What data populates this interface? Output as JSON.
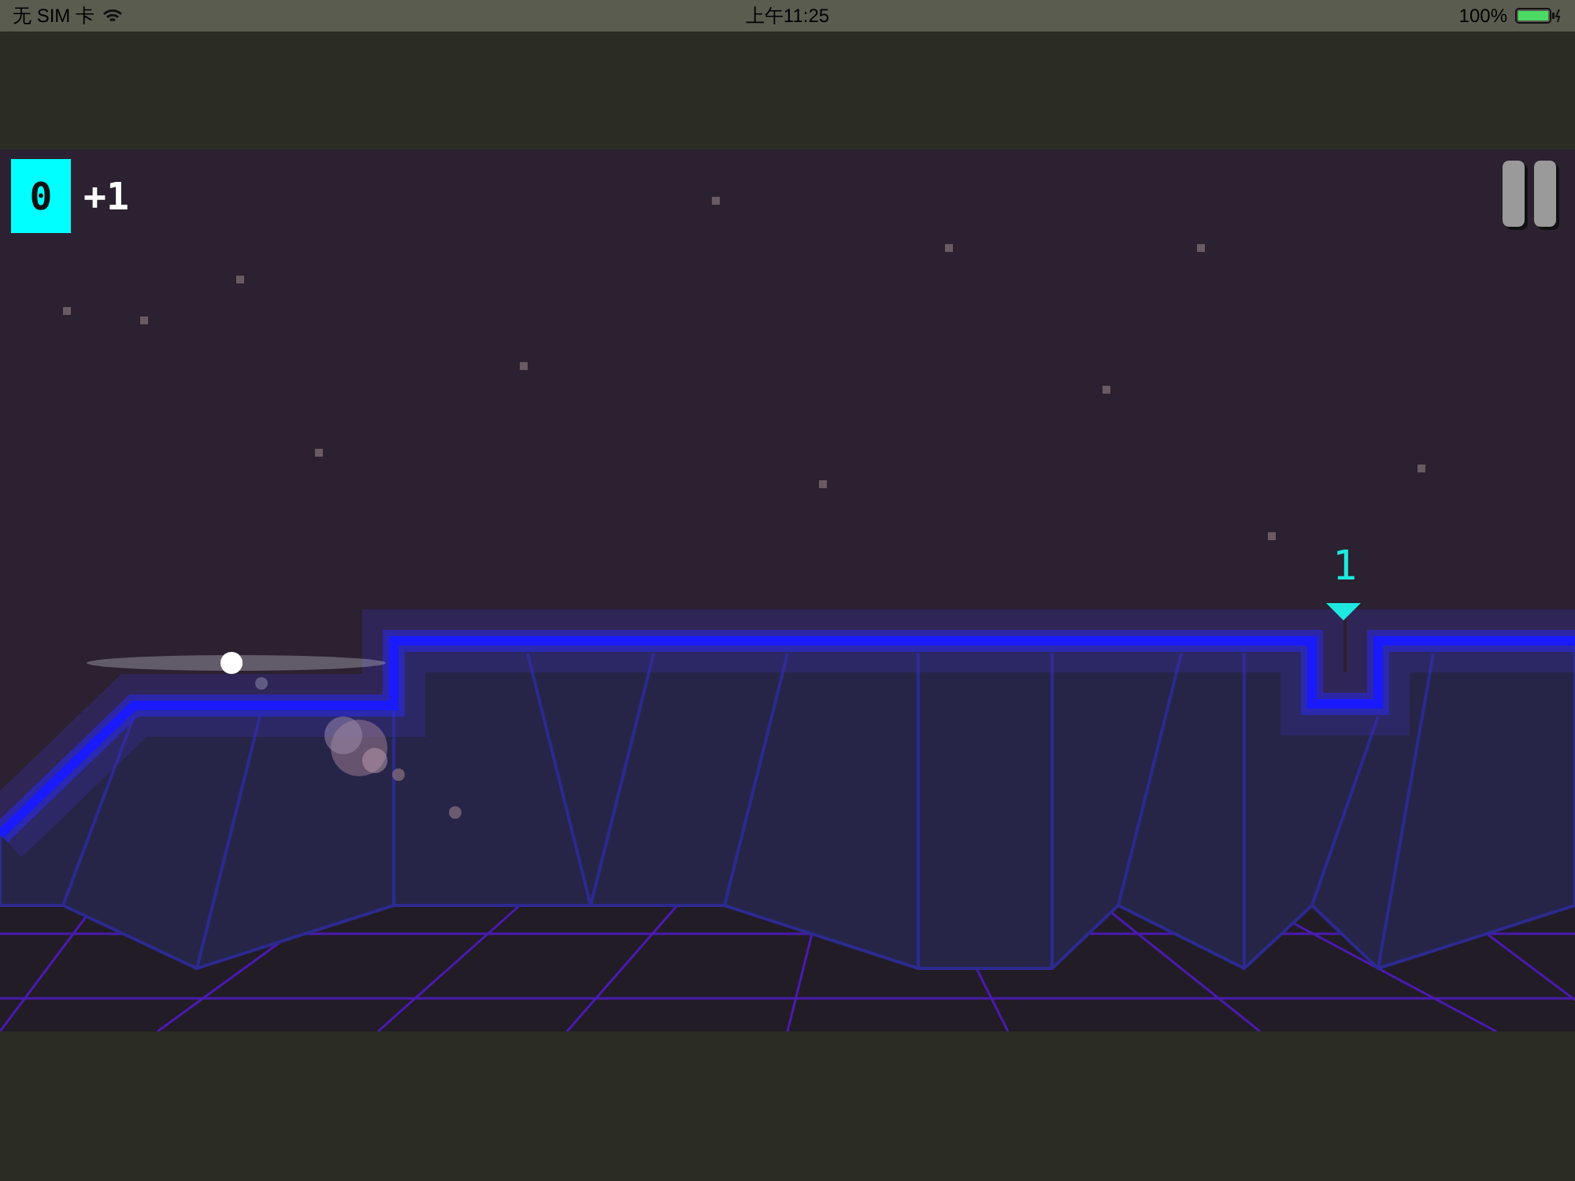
{
  "status_bar": {
    "carrier": "无 SIM 卡",
    "time": "上午11:25",
    "battery": "100%"
  },
  "hud": {
    "score": "0",
    "bonus": "+1"
  },
  "marker": {
    "label": "1"
  }
}
